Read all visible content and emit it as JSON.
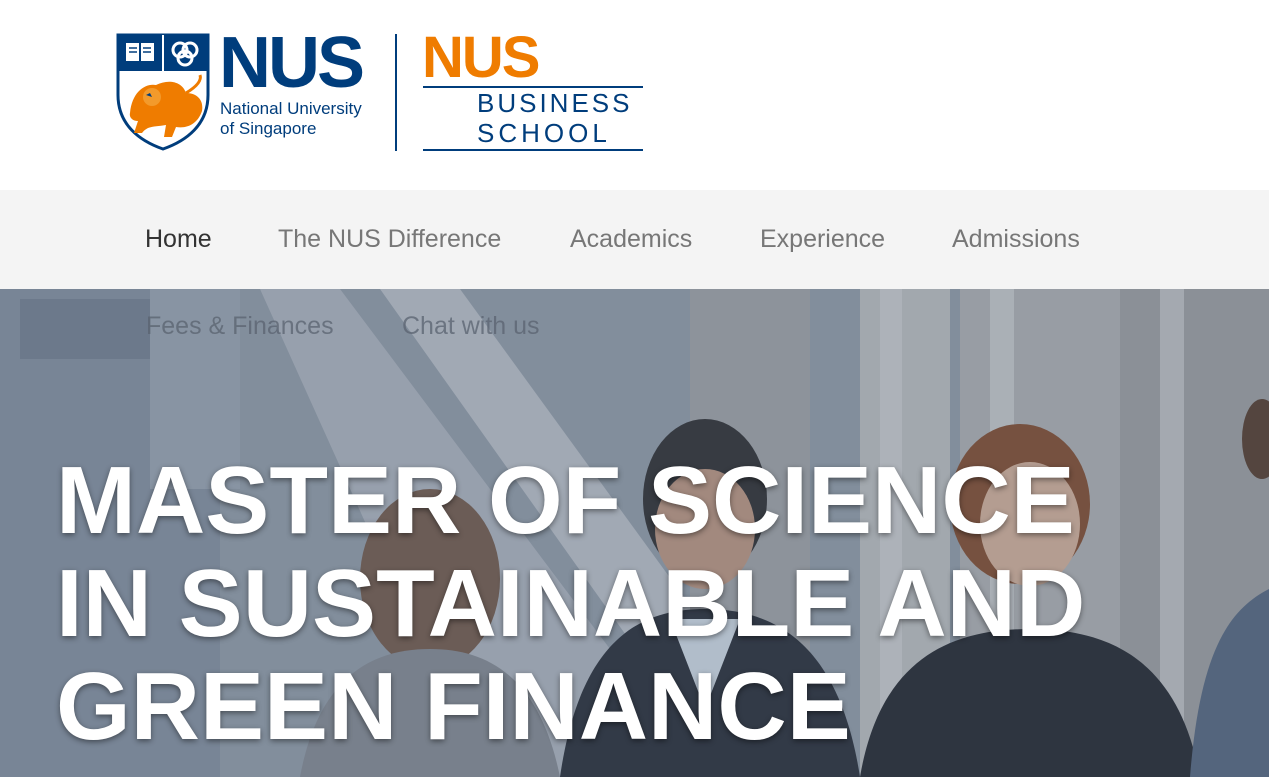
{
  "logo": {
    "university_wordmark": "NUS",
    "university_name_line1": "National University",
    "university_name_line2": "of Singapore",
    "school_wordmark": "NUS",
    "school_name_line1": "BUSINESS",
    "school_name_line2": "SCHOOL",
    "colors": {
      "nus_blue": "#003d7c",
      "nus_orange": "#ef7c00"
    }
  },
  "nav": {
    "items": [
      {
        "label": "Home",
        "active": true
      },
      {
        "label": "The NUS Difference",
        "active": false
      },
      {
        "label": "Academics",
        "active": false
      },
      {
        "label": "Experience",
        "active": false
      },
      {
        "label": "Admissions",
        "active": false
      },
      {
        "label": "Fees & Finances",
        "active": false
      },
      {
        "label": "Chat with us",
        "active": false
      }
    ]
  },
  "hero": {
    "title_lines": [
      "MASTER OF SCIENCE",
      "IN SUSTAINABLE AND",
      "GREEN FINANCE"
    ]
  }
}
